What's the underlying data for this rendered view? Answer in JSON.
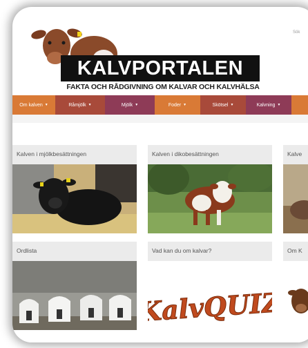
{
  "header": {
    "brand_title": "KALVPORTALEN",
    "tagline": "FAKTA OCH RÅDGIVNING OM KALVAR OCH KALVHÄLSA",
    "search_link": "Sök"
  },
  "nav": {
    "items": [
      {
        "label": "Om kalven",
        "color": "#d97a36"
      },
      {
        "label": "Råmjölk",
        "color": "#a84a3a"
      },
      {
        "label": "Mjölk",
        "color": "#8e3b57"
      },
      {
        "label": "Foder",
        "color": "#d97a36"
      },
      {
        "label": "Skötsel",
        "color": "#a84a3a"
      },
      {
        "label": "Kalvning",
        "color": "#8e3b57"
      },
      {
        "label": "",
        "color": "#d97a36"
      }
    ]
  },
  "cards": [
    {
      "title": "Kalven i mjölkbesättningen"
    },
    {
      "title": "Kalven i dikobesättningen"
    },
    {
      "title": "Kalve"
    },
    {
      "title": "Ordlista"
    },
    {
      "title": "Vad kan du om kalvar?"
    },
    {
      "title": "Om K"
    }
  ],
  "quiz_logo_text": "KalvQUIZ"
}
